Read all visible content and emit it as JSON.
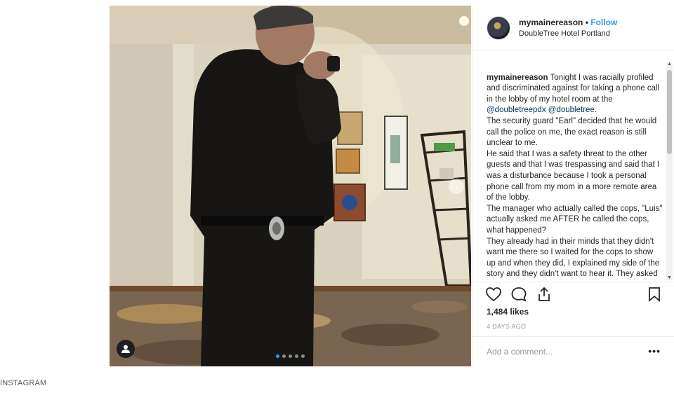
{
  "post": {
    "username": "mymainereason",
    "separator": "•",
    "follow_label": "Follow",
    "location": "DoubleTree Hotel Portland",
    "caption": {
      "part1": " Tonight I was racially profiled and discriminated against for taking a phone call in the lobby of my hotel room at the ",
      "mention1": "@doubletreepdx",
      "space": " ",
      "mention2": "@doubletree",
      "part2": ".\nThe security guard \"Earl\" decided that he would call the police on me, the exact reason is still unclear to me.\nHe said that I was a safety threat to the other guests and that I was trespassing and said that I was a disturbance because I took a personal phone call from my mom in a more remote area of the lobby.\nThe manager who actually called the cops, \"Luis\" actually asked me AFTER he called the cops, what happened?\nThey already had in their minds that they didn't want me there so I waited for the cops to show up and when they did, I explained my side of the story and they didn't want to hear it. They asked me if I had personal items in my room (which of"
    },
    "likes": "1,484 likes",
    "time_ago": "4 DAYS AGO",
    "comment_placeholder": "Add a comment...",
    "more_label": "•••",
    "carousel": {
      "count": 5,
      "active_index": 0
    },
    "icons": [
      "heart-icon",
      "comment-icon",
      "share-icon",
      "bookmark-icon",
      "user-tag-icon",
      "chevron-right-icon"
    ]
  },
  "credit": "INSTAGRAM",
  "colors": {
    "link": "#3897f0",
    "mention": "#003569",
    "muted": "#999999"
  }
}
